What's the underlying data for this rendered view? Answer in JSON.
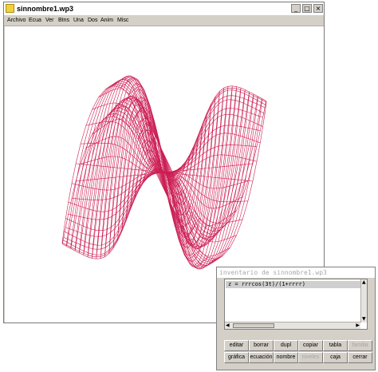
{
  "main_window": {
    "title": "sinnombre1.wp3",
    "controls": {
      "minimize": "_",
      "maximize": "□",
      "close": "×"
    },
    "menu": [
      "Archivo",
      "Ecua",
      "Ver",
      "Btns",
      "Una",
      "Dos",
      "Anim",
      "Misc"
    ]
  },
  "surface": {
    "equation": "z = rrrcos(3t)/(1+rrrr)",
    "line_color": "#cc1f55"
  },
  "inventory_window": {
    "title": "inventario de sinnombre1.wp3",
    "entries": [
      "z = rrrcos(3t)/(1+rrrr)"
    ],
    "buttons_row1": [
      {
        "label": "editar",
        "enabled": true
      },
      {
        "label": "borrar",
        "enabled": true
      },
      {
        "label": "dupl",
        "enabled": true
      },
      {
        "label": "copiar",
        "enabled": true
      },
      {
        "label": "tabla",
        "enabled": true
      },
      {
        "label": "familia",
        "enabled": false
      }
    ],
    "buttons_row2": [
      {
        "label": "gráfica",
        "enabled": true
      },
      {
        "label": "ecuación",
        "enabled": true
      },
      {
        "label": "nombre",
        "enabled": true
      },
      {
        "label": "niveles",
        "enabled": false
      },
      {
        "label": "caja",
        "enabled": true
      },
      {
        "label": "cerrar",
        "enabled": true
      }
    ]
  }
}
